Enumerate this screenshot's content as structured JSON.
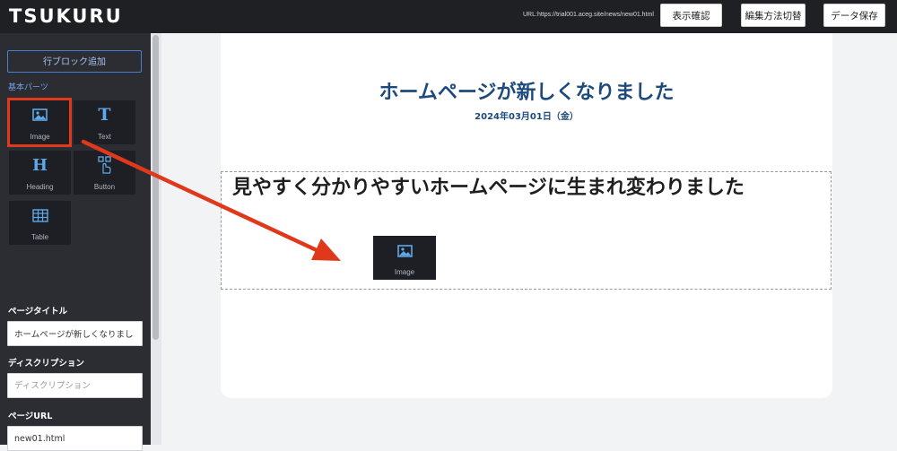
{
  "header": {
    "logo": "TSUKURU",
    "url": "URL:https://trial001.aceg.site/news/new01.html",
    "preview_label": "表示確認",
    "switch_label": "編集方法切替",
    "save_label": "データ保存"
  },
  "sidebar": {
    "add_row_label": "行ブロック追加",
    "section_label": "基本パーツ",
    "parts": [
      {
        "label": "Image",
        "icon": "image-icon"
      },
      {
        "label": "Text",
        "icon": "text-icon"
      },
      {
        "label": "Heading",
        "icon": "heading-icon"
      },
      {
        "label": "Button",
        "icon": "button-icon"
      },
      {
        "label": "Table",
        "icon": "table-icon"
      }
    ],
    "fields": {
      "page_title_label": "ページタイトル",
      "page_title_value": "ホームページが新しくなりまし",
      "description_label": "ディスクリプション",
      "description_placeholder": "ディスクリプション",
      "url_label": "ページURL",
      "url_value": "new01.html"
    }
  },
  "page": {
    "title": "ホームページが新しくなりました",
    "date": "2024年03月01日（金）",
    "heading": "見やすく分かりやすいホームページに生まれ変わりました",
    "drag_label": "Image"
  },
  "colors": {
    "header_bg": "#1f2023",
    "sidebar_bg": "#2b2d33",
    "accent_blue": "#1d4a7c",
    "highlight_red": "#e0381b"
  }
}
